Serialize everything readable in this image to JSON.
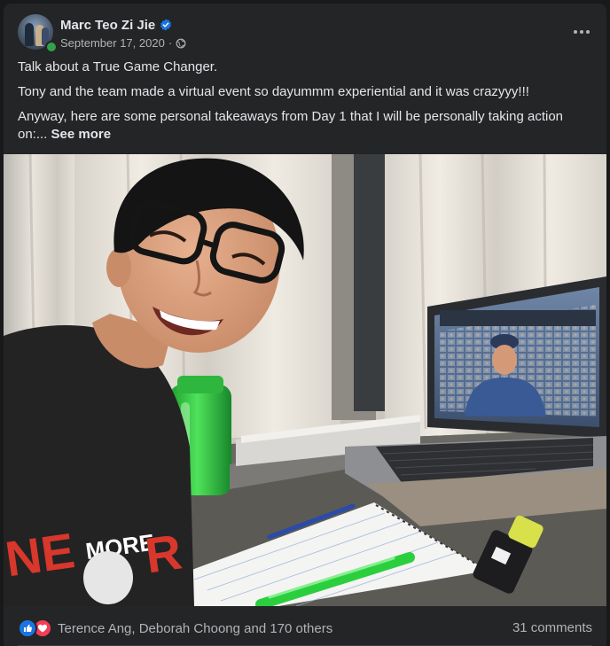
{
  "post": {
    "author": "Marc Teo Zi Jie",
    "date": "September 17, 2020",
    "separator": "·",
    "paragraphs": [
      "Talk about a True Game Changer.",
      "Tony and the team made a virtual event so dayummm experiential and it was crazyyy!!!",
      "Anyway, here are some personal takeaways from Day 1 that I will be personally taking action on:..."
    ],
    "see_more_label": "See more",
    "shirt_text": "MORE",
    "shirt_text_left": "NE",
    "shirt_text_right": "R"
  },
  "footer": {
    "reaction_names": "Terence Ang, Deborah Choong and 170 others",
    "comments": "31 comments"
  },
  "icons": {
    "verified": "verified-badge-icon",
    "audience": "globe-icon",
    "more": "more-options-icon",
    "like": "like-reaction-icon",
    "love": "love-reaction-icon"
  },
  "colors": {
    "accent": "#1b74e4",
    "online": "#31a24c",
    "love": "#f33e58",
    "background": "#242526"
  }
}
